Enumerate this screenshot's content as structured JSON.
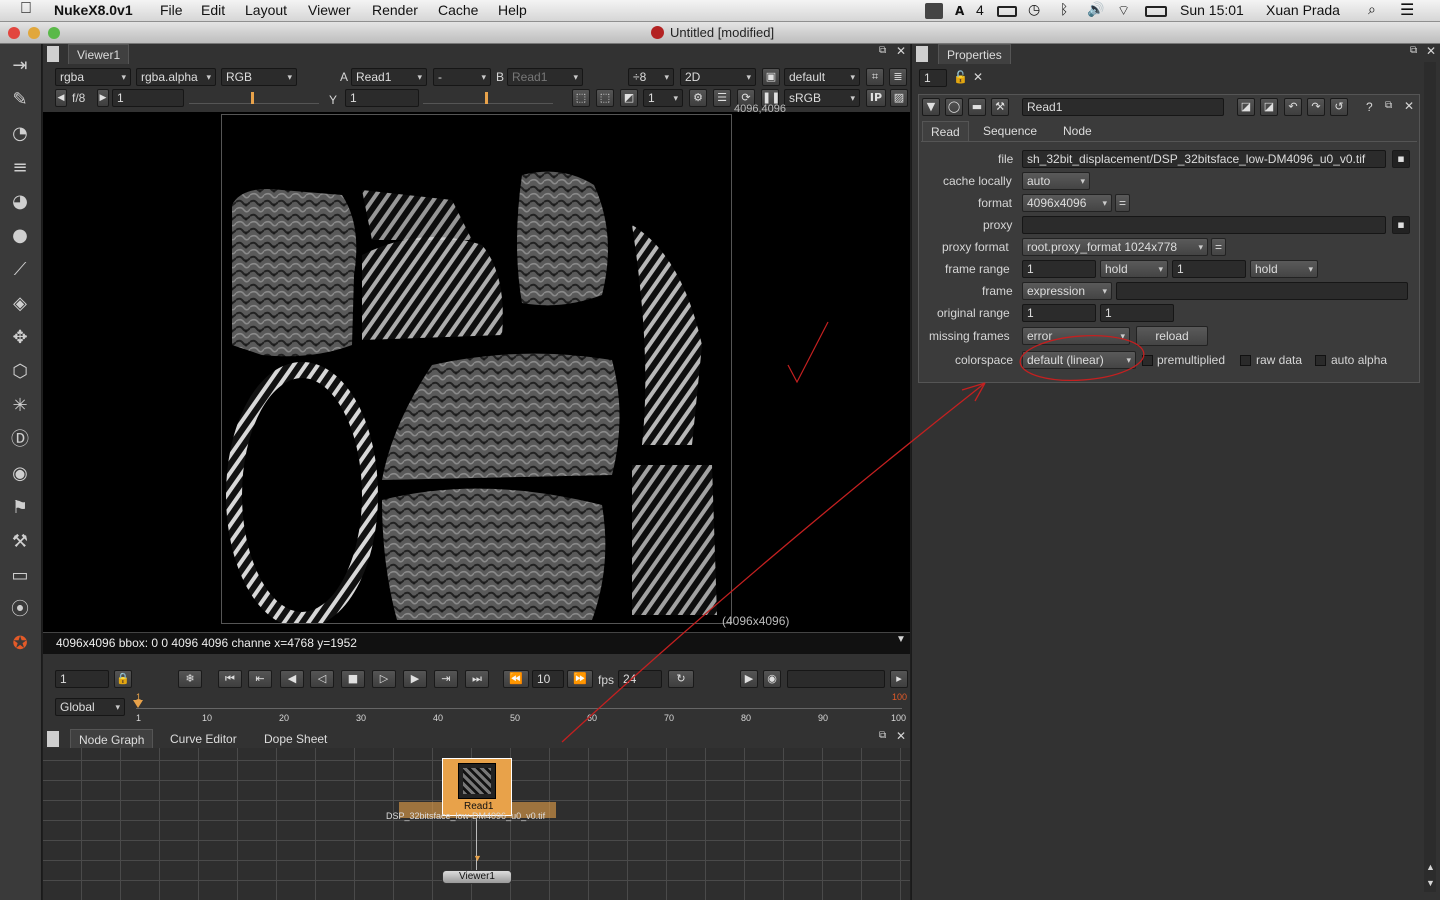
{
  "menubar": {
    "app_name": "NukeX8.0v1",
    "items": [
      "File",
      "Edit",
      "Layout",
      "Viewer",
      "Render",
      "Cache",
      "Help"
    ],
    "status_adobe": "4",
    "clock": "Sun 15:01",
    "user": "Xuan Prada"
  },
  "window": {
    "title": "Untitled [modified]"
  },
  "viewer": {
    "tab": "Viewer1",
    "channels": "rgba",
    "alpha": "rgba.alpha",
    "display_channels": "RGB",
    "a_label": "A",
    "a_input": "Read1",
    "operation": "-",
    "b_label": "B",
    "b_input": "Read1",
    "downrez": "÷8",
    "mode": "2D",
    "lut_set": "default",
    "fstop": "f/8",
    "gain": "1",
    "y_label": "Y",
    "gamma": "1",
    "proxy_scale": "1",
    "colorspace": "sRGB",
    "ip": "IP",
    "top_right_coord": "4096,4096",
    "bottom_right_coord": "(4096x4096)",
    "info_line": "4096x4096 bbox: 0 0 4096 4096 channe  x=4768 y=1952"
  },
  "timeline": {
    "frame": "1",
    "step": "10",
    "fps_label": "fps",
    "fps": "24",
    "range_mode": "Global",
    "end_frame_marker": "100",
    "start_marker": "1",
    "ticks": [
      "1",
      "10",
      "20",
      "30",
      "40",
      "50",
      "60",
      "70",
      "80",
      "90",
      "100"
    ]
  },
  "bottom_tabs": [
    "Node Graph",
    "Curve Editor",
    "Dope Sheet"
  ],
  "nodes": {
    "read_label": "Read1",
    "read_file": "DSP_32bitsface_low-DM4096_u0_v0.tif",
    "viewer_label": "Viewer1"
  },
  "properties": {
    "tab": "Properties",
    "max_panels": "1",
    "node_name": "Read1",
    "tabs": [
      "Read",
      "Sequence",
      "Node"
    ],
    "fields": {
      "file_label": "file",
      "file_value": "sh_32bit_displacement/DSP_32bitsface_low-DM4096_u0_v0.tif",
      "cache_label": "cache locally",
      "cache_value": "auto",
      "format_label": "format",
      "format_value": "4096x4096",
      "proxy_label": "proxy",
      "proxy_value": "",
      "proxy_format_label": "proxy format",
      "proxy_format_value": "root.proxy_format 1024x778",
      "frame_range_label": "frame range",
      "frame_start": "1",
      "before": "hold",
      "frame_end": "1",
      "after": "hold",
      "frame_label": "frame",
      "frame_mode": "expression",
      "frame_expr": "",
      "original_range_label": "original range",
      "orig_start": "1",
      "orig_end": "1",
      "missing_frames_label": "missing frames",
      "missing_frames_value": "error",
      "reload_label": "reload",
      "colorspace_label": "colorspace",
      "colorspace_value": "default (linear)",
      "premultiplied_label": "premultiplied",
      "raw_data_label": "raw data",
      "auto_alpha_label": "auto alpha"
    }
  },
  "colors": {
    "accent_orange": "#e8a24a",
    "annotation_red": "#c42020"
  },
  "icons": [
    "apple-icon",
    "spotlight-icon",
    "list-icon",
    "wifi-icon",
    "bluetooth-icon",
    "volume-icon",
    "battery-icon",
    "time-machine-icon"
  ]
}
